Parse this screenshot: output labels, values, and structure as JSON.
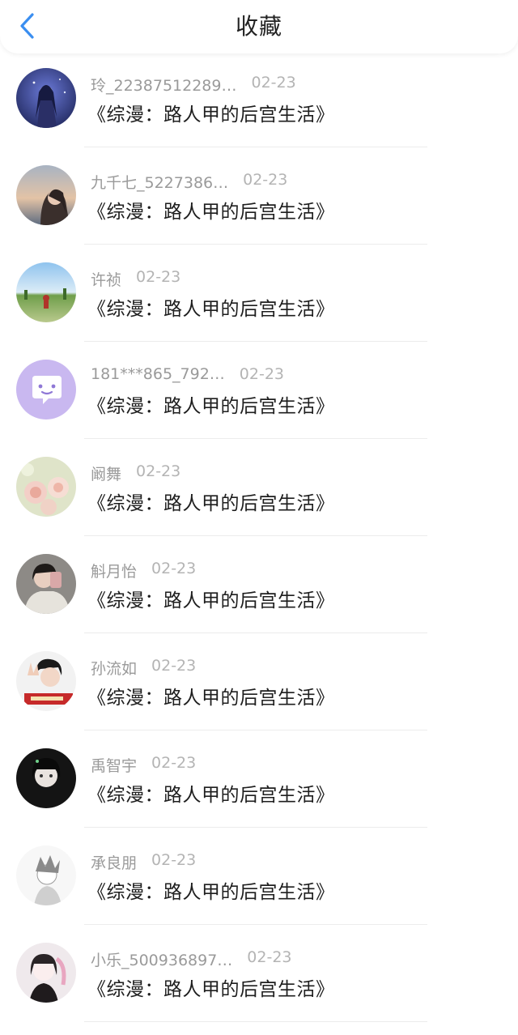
{
  "header": {
    "title": "收藏",
    "back_icon": "chevron-left-icon",
    "accent_color": "#3a8ef0"
  },
  "items": [
    {
      "name": "玲_22387512289…",
      "date": "02-23",
      "book": "《综漫：路人甲的后宫生活》",
      "avatar": "anime-girl-night"
    },
    {
      "name": "九千七_5227386…",
      "date": "02-23",
      "book": "《综漫：路人甲的后宫生活》",
      "avatar": "girl-sunset"
    },
    {
      "name": "许祯",
      "date": "02-23",
      "book": "《综漫：路人甲的后宫生活》",
      "avatar": "landscape-field"
    },
    {
      "name": "181***865_792…",
      "date": "02-23",
      "book": "《综漫：路人甲的后宫生活》",
      "avatar": "default-chat"
    },
    {
      "name": "阚舞",
      "date": "02-23",
      "book": "《综漫：路人甲的后宫生活》",
      "avatar": "roses"
    },
    {
      "name": "斛月怡",
      "date": "02-23",
      "book": "《综漫：路人甲的后宫生活》",
      "avatar": "girl-selfie"
    },
    {
      "name": "孙流如",
      "date": "02-23",
      "book": "《综漫：路人甲的后宫生活》",
      "avatar": "boy-peace-sign"
    },
    {
      "name": "禹智宇",
      "date": "02-23",
      "book": "《综漫：路人甲的后宫生活》",
      "avatar": "dark-portrait"
    },
    {
      "name": "承良朋",
      "date": "02-23",
      "book": "《综漫：路人甲的后宫生活》",
      "avatar": "anime-boy-sketch"
    },
    {
      "name": "小乐_500936897…",
      "date": "02-23",
      "book": "《综漫：路人甲的后宫生活》",
      "avatar": "anime-girl-pink"
    }
  ]
}
